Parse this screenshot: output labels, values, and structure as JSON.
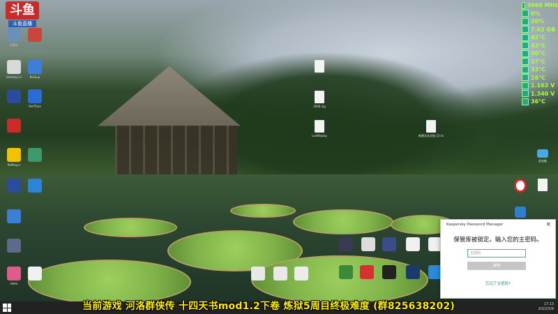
{
  "overlay": {
    "logo_text": "斗鱼",
    "logo_sub": "斗鱼直播"
  },
  "system_monitor": [
    {
      "icon": "cpu-clock-icon",
      "value": "3660 MHz"
    },
    {
      "icon": "cpu-load-icon",
      "value": "0%"
    },
    {
      "icon": "gpu-load-icon",
      "value": "20%"
    },
    {
      "icon": "memory-icon",
      "value": "7.62 GB"
    },
    {
      "icon": "temp-icon",
      "value": "42°C"
    },
    {
      "icon": "temp-icon",
      "value": "43°C"
    },
    {
      "icon": "temp-icon",
      "value": "40°C"
    },
    {
      "icon": "temp-icon",
      "value": "37°C"
    },
    {
      "icon": "temp-icon",
      "value": "33°C"
    },
    {
      "icon": "temp-icon",
      "value": "16°C"
    },
    {
      "icon": "voltage-icon",
      "value": "1.162 V"
    },
    {
      "icon": "voltage-icon",
      "value": "1.340 V"
    },
    {
      "icon": "temp-icon",
      "value": "36°C"
    }
  ],
  "desktop_icons_left": [
    {
      "label": "回收站",
      "color": "#6b8fb5"
    },
    {
      "label": "",
      "color": "#c9463d"
    },
    {
      "label": "desktop.ini",
      "color": "#d9d9d9"
    },
    {
      "label": "Backup",
      "color": "#3c7fd6"
    },
    {
      "label": "",
      "color": "#2b4b9b"
    },
    {
      "label": "PerfTime",
      "color": "#2b6bd6"
    },
    {
      "label": "",
      "color": "#c92b2b"
    },
    {
      "label": "PotPlayer",
      "color": "#f2c200"
    },
    {
      "label": "",
      "color": "#3c9a6a"
    },
    {
      "label": "",
      "color": "#2b4b9b"
    },
    {
      "label": "",
      "color": "#2b84d6"
    },
    {
      "label": "",
      "color": "#3c7fd6"
    },
    {
      "label": "",
      "color": "#5d6a8a"
    },
    {
      "label": "Hello",
      "color": "#e05a8a"
    },
    {
      "label": "",
      "color": "#f0f0f0"
    }
  ],
  "desktop_files_mid": [
    {
      "label": ""
    },
    {
      "label": "2006.log"
    },
    {
      "label": "LastReplay"
    }
  ],
  "desktop_icons_right": [
    {
      "label": "新建文本文档 (2).txt"
    },
    {
      "label": "此电脑"
    }
  ],
  "dialog": {
    "title": "Kaspersky Password Manager",
    "close_label": "×",
    "message": "保管库被锁定。输入您的主密码。",
    "password_placeholder": "主密码",
    "unlock_label": "解锁",
    "forgot_label": "忘记了主密码?"
  },
  "taskbar": {
    "time": "17:13",
    "date": "2022/5/9"
  },
  "banner_text": "当前游戏 河洛群侠传  十四天书mod1.2下卷  炼狱5周目终极难度  (群825638202)"
}
